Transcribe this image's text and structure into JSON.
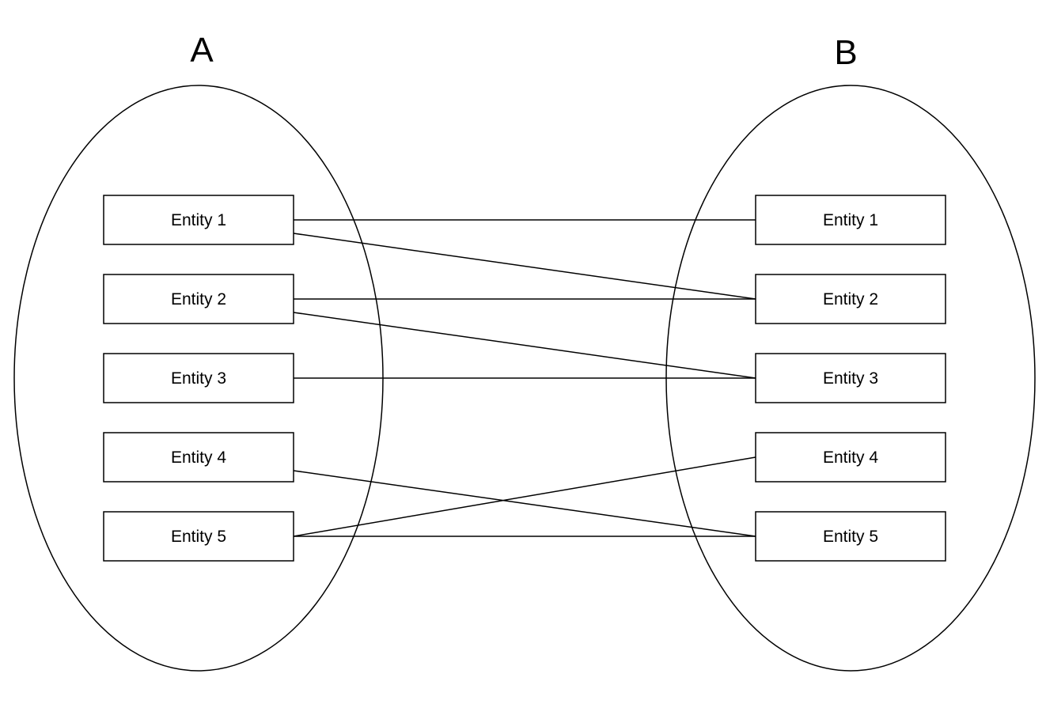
{
  "sets": [
    {
      "label": "A",
      "entities": [
        "Entity 1",
        "Entity 2",
        "Entity 3",
        "Entity 4",
        "Entity 5"
      ]
    },
    {
      "label": "B",
      "entities": [
        "Entity 1",
        "Entity 2",
        "Entity 3",
        "Entity 4",
        "Entity 5"
      ]
    }
  ],
  "connections": [
    {
      "from": "A.Entity 1",
      "to": "B.Entity 1"
    },
    {
      "from": "A.Entity 1",
      "to": "B.Entity 2"
    },
    {
      "from": "A.Entity 2",
      "to": "B.Entity 2"
    },
    {
      "from": "A.Entity 2",
      "to": "B.Entity 3"
    },
    {
      "from": "A.Entity 3",
      "to": "B.Entity 3"
    },
    {
      "from": "A.Entity 4",
      "to": "B.Entity 5"
    },
    {
      "from": "A.Entity 5",
      "to": "B.Entity 4"
    },
    {
      "from": "A.Entity 5",
      "to": "B.Entity 5"
    }
  ],
  "colors": {
    "stroke": "#000000",
    "background": "#ffffff"
  }
}
